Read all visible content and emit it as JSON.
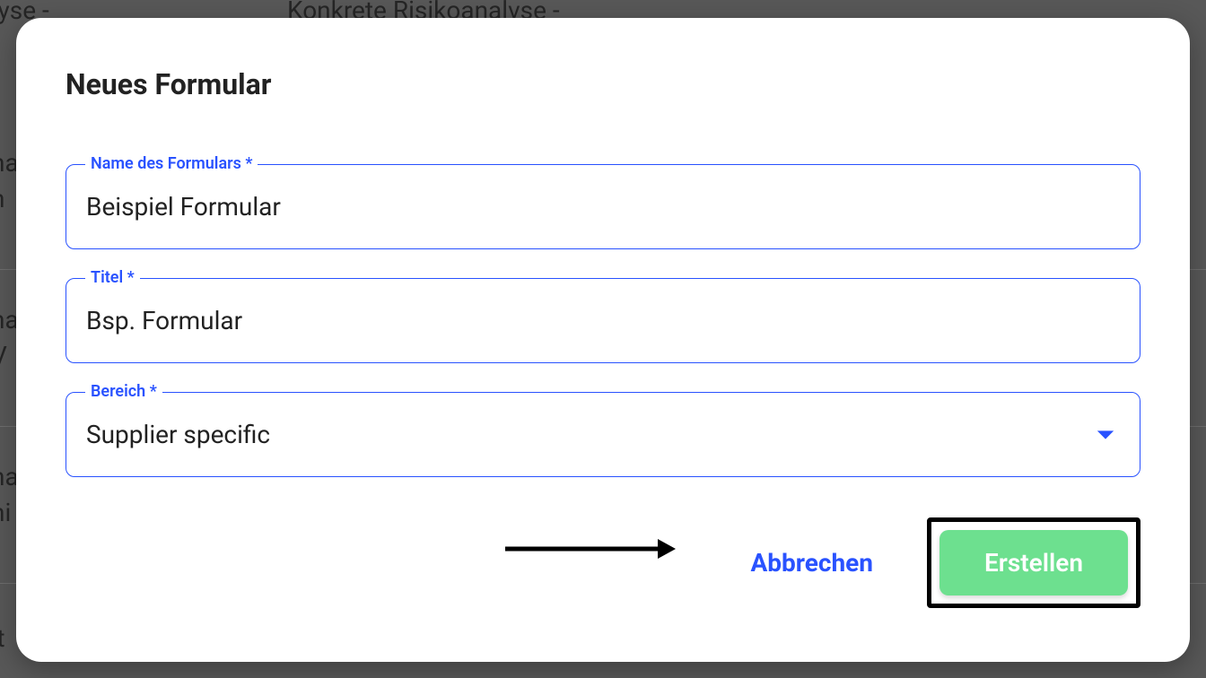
{
  "background": {
    "text1": "nalyse -",
    "text2": "Konkrete Risikoanalvse -",
    "text3": "na",
    "text3b": "h",
    "text4": "na",
    "text4b": "V",
    "text5": "na",
    "text5b": "ni",
    "text6": "r t"
  },
  "modal": {
    "title": "Neues Formular",
    "fields": {
      "name": {
        "label": "Name des Formulars *",
        "value": "Beispiel Formular"
      },
      "titel": {
        "label": "Titel *",
        "value": "Bsp. Formular"
      },
      "bereich": {
        "label": "Bereich *",
        "value": "Supplier specific"
      }
    },
    "actions": {
      "cancel": "Abbrechen",
      "create": "Erstellen"
    }
  }
}
